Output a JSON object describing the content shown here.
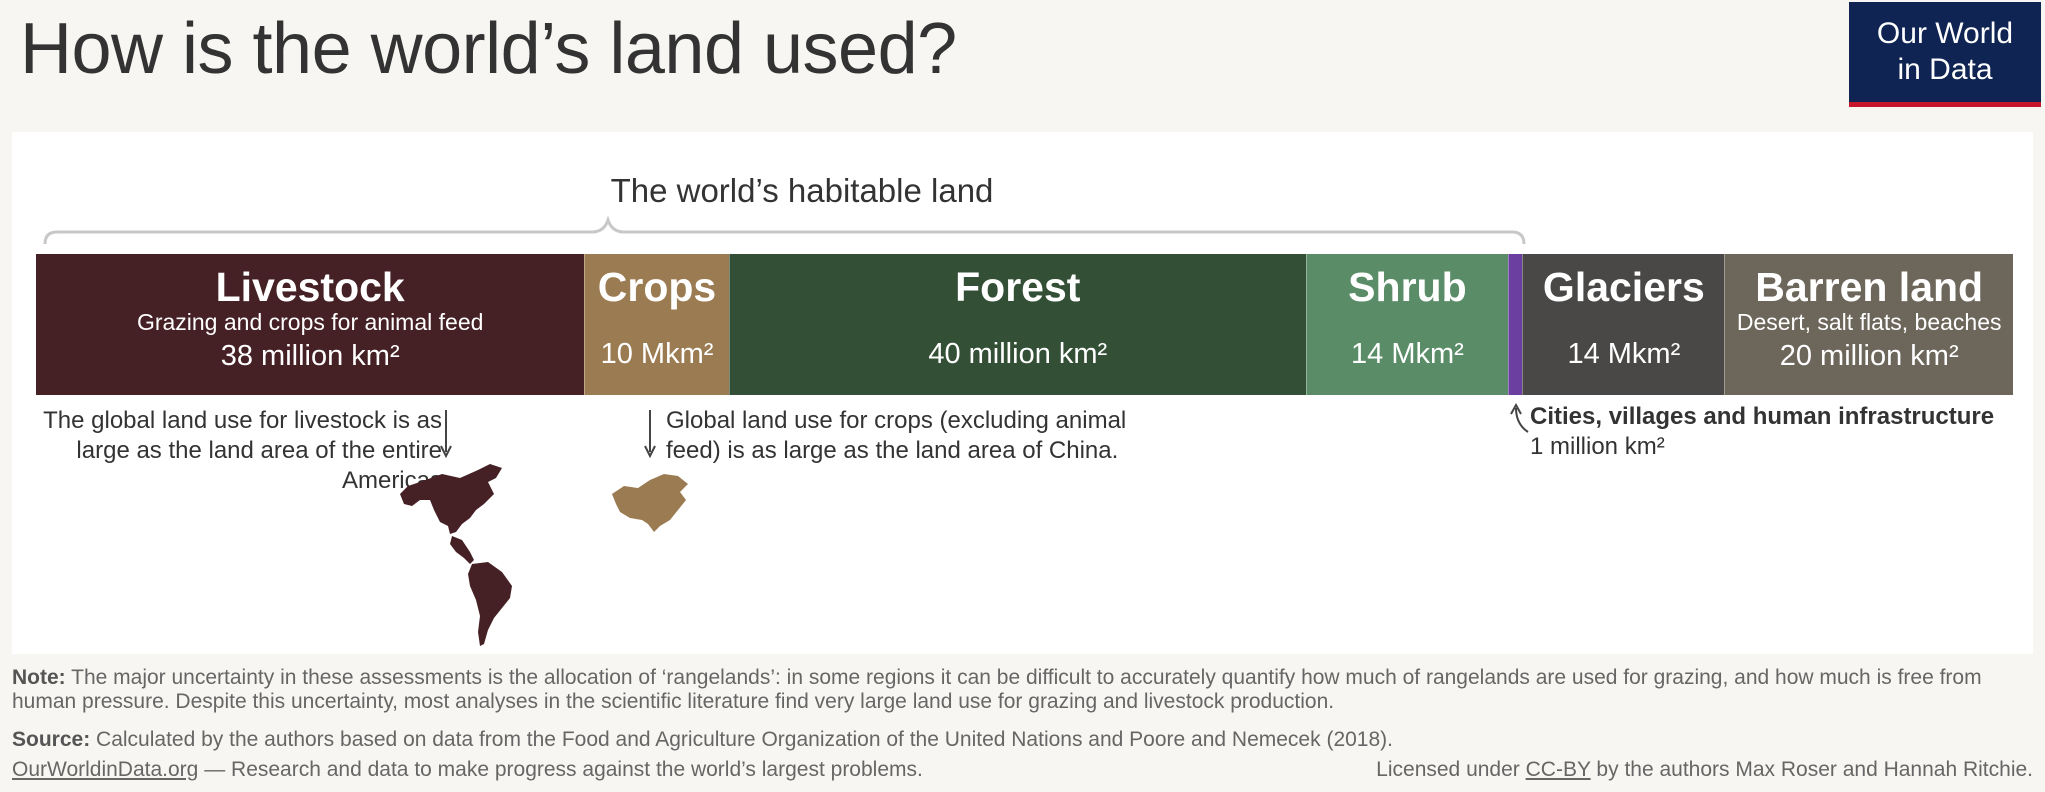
{
  "title": "How is the world’s land used?",
  "logo": {
    "line1": "Our World",
    "line2": "in Data"
  },
  "bracket_label": "The world’s habitable land",
  "chart_data": {
    "type": "bar",
    "orientation": "horizontal-stacked",
    "units": "million km²",
    "categories": [
      "Livestock",
      "Crops",
      "Forest",
      "Shrub",
      "Cities, villages and human infrastructure",
      "Glaciers",
      "Barren land"
    ],
    "values": [
      38,
      10,
      40,
      14,
      1,
      14,
      20
    ],
    "colors": [
      "#452025",
      "#9b7b51",
      "#335036",
      "#5a8d67",
      "#6b3fa0",
      "#494847",
      "#6d665b"
    ],
    "habitable_span": [
      "Livestock",
      "Crops",
      "Forest",
      "Shrub",
      "Cities, villages and human infrastructure"
    ],
    "segments": [
      {
        "name": "Livestock",
        "sub": "Grazing and crops for animal feed",
        "value_label": "38 million km²"
      },
      {
        "name": "Crops",
        "sub": "",
        "value_label": "10 Mkm²"
      },
      {
        "name": "Forest",
        "sub": "",
        "value_label": "40 million km²"
      },
      {
        "name": "Shrub",
        "sub": "",
        "value_label": "14 Mkm²"
      },
      {
        "name": "",
        "sub": "",
        "value_label": ""
      },
      {
        "name": "Glaciers",
        "sub": "",
        "value_label": "14 Mkm²"
      },
      {
        "name": "Barren land",
        "sub": "Desert, salt flats, beaches",
        "value_label": "20 million km²"
      }
    ]
  },
  "annotations": {
    "livestock": "The global land use for livestock is as large as the land area of the entire Americas",
    "crops": "Global land use for crops (excluding animal feed) is as large as the land area of China.",
    "cities_title": "Cities, villages and human infrastructure",
    "cities_value": "1 million km²"
  },
  "note": {
    "label": "Note:",
    "text": "The major uncertainty in these assessments is the allocation of ‘rangelands’: in some regions it can be difficult to accurately quantify how much of rangelands are used for grazing, and how much is free from human pressure. Despite this uncertainty, most analyses in the scientific literature find very large land use for grazing and livestock production."
  },
  "source": {
    "label": "Source:",
    "text": "Calculated by the authors based on data from the Food and Agriculture Organization of the United Nations and Poore and Nemecek (2018)."
  },
  "footer": {
    "site": "OurWorldinData.org",
    "tagline": " — Research and data to make progress against the world’s largest problems.",
    "license_pre": "Licensed under ",
    "license": "CC-BY",
    "license_post": " by the authors Max Roser and Hannah Ritchie."
  }
}
